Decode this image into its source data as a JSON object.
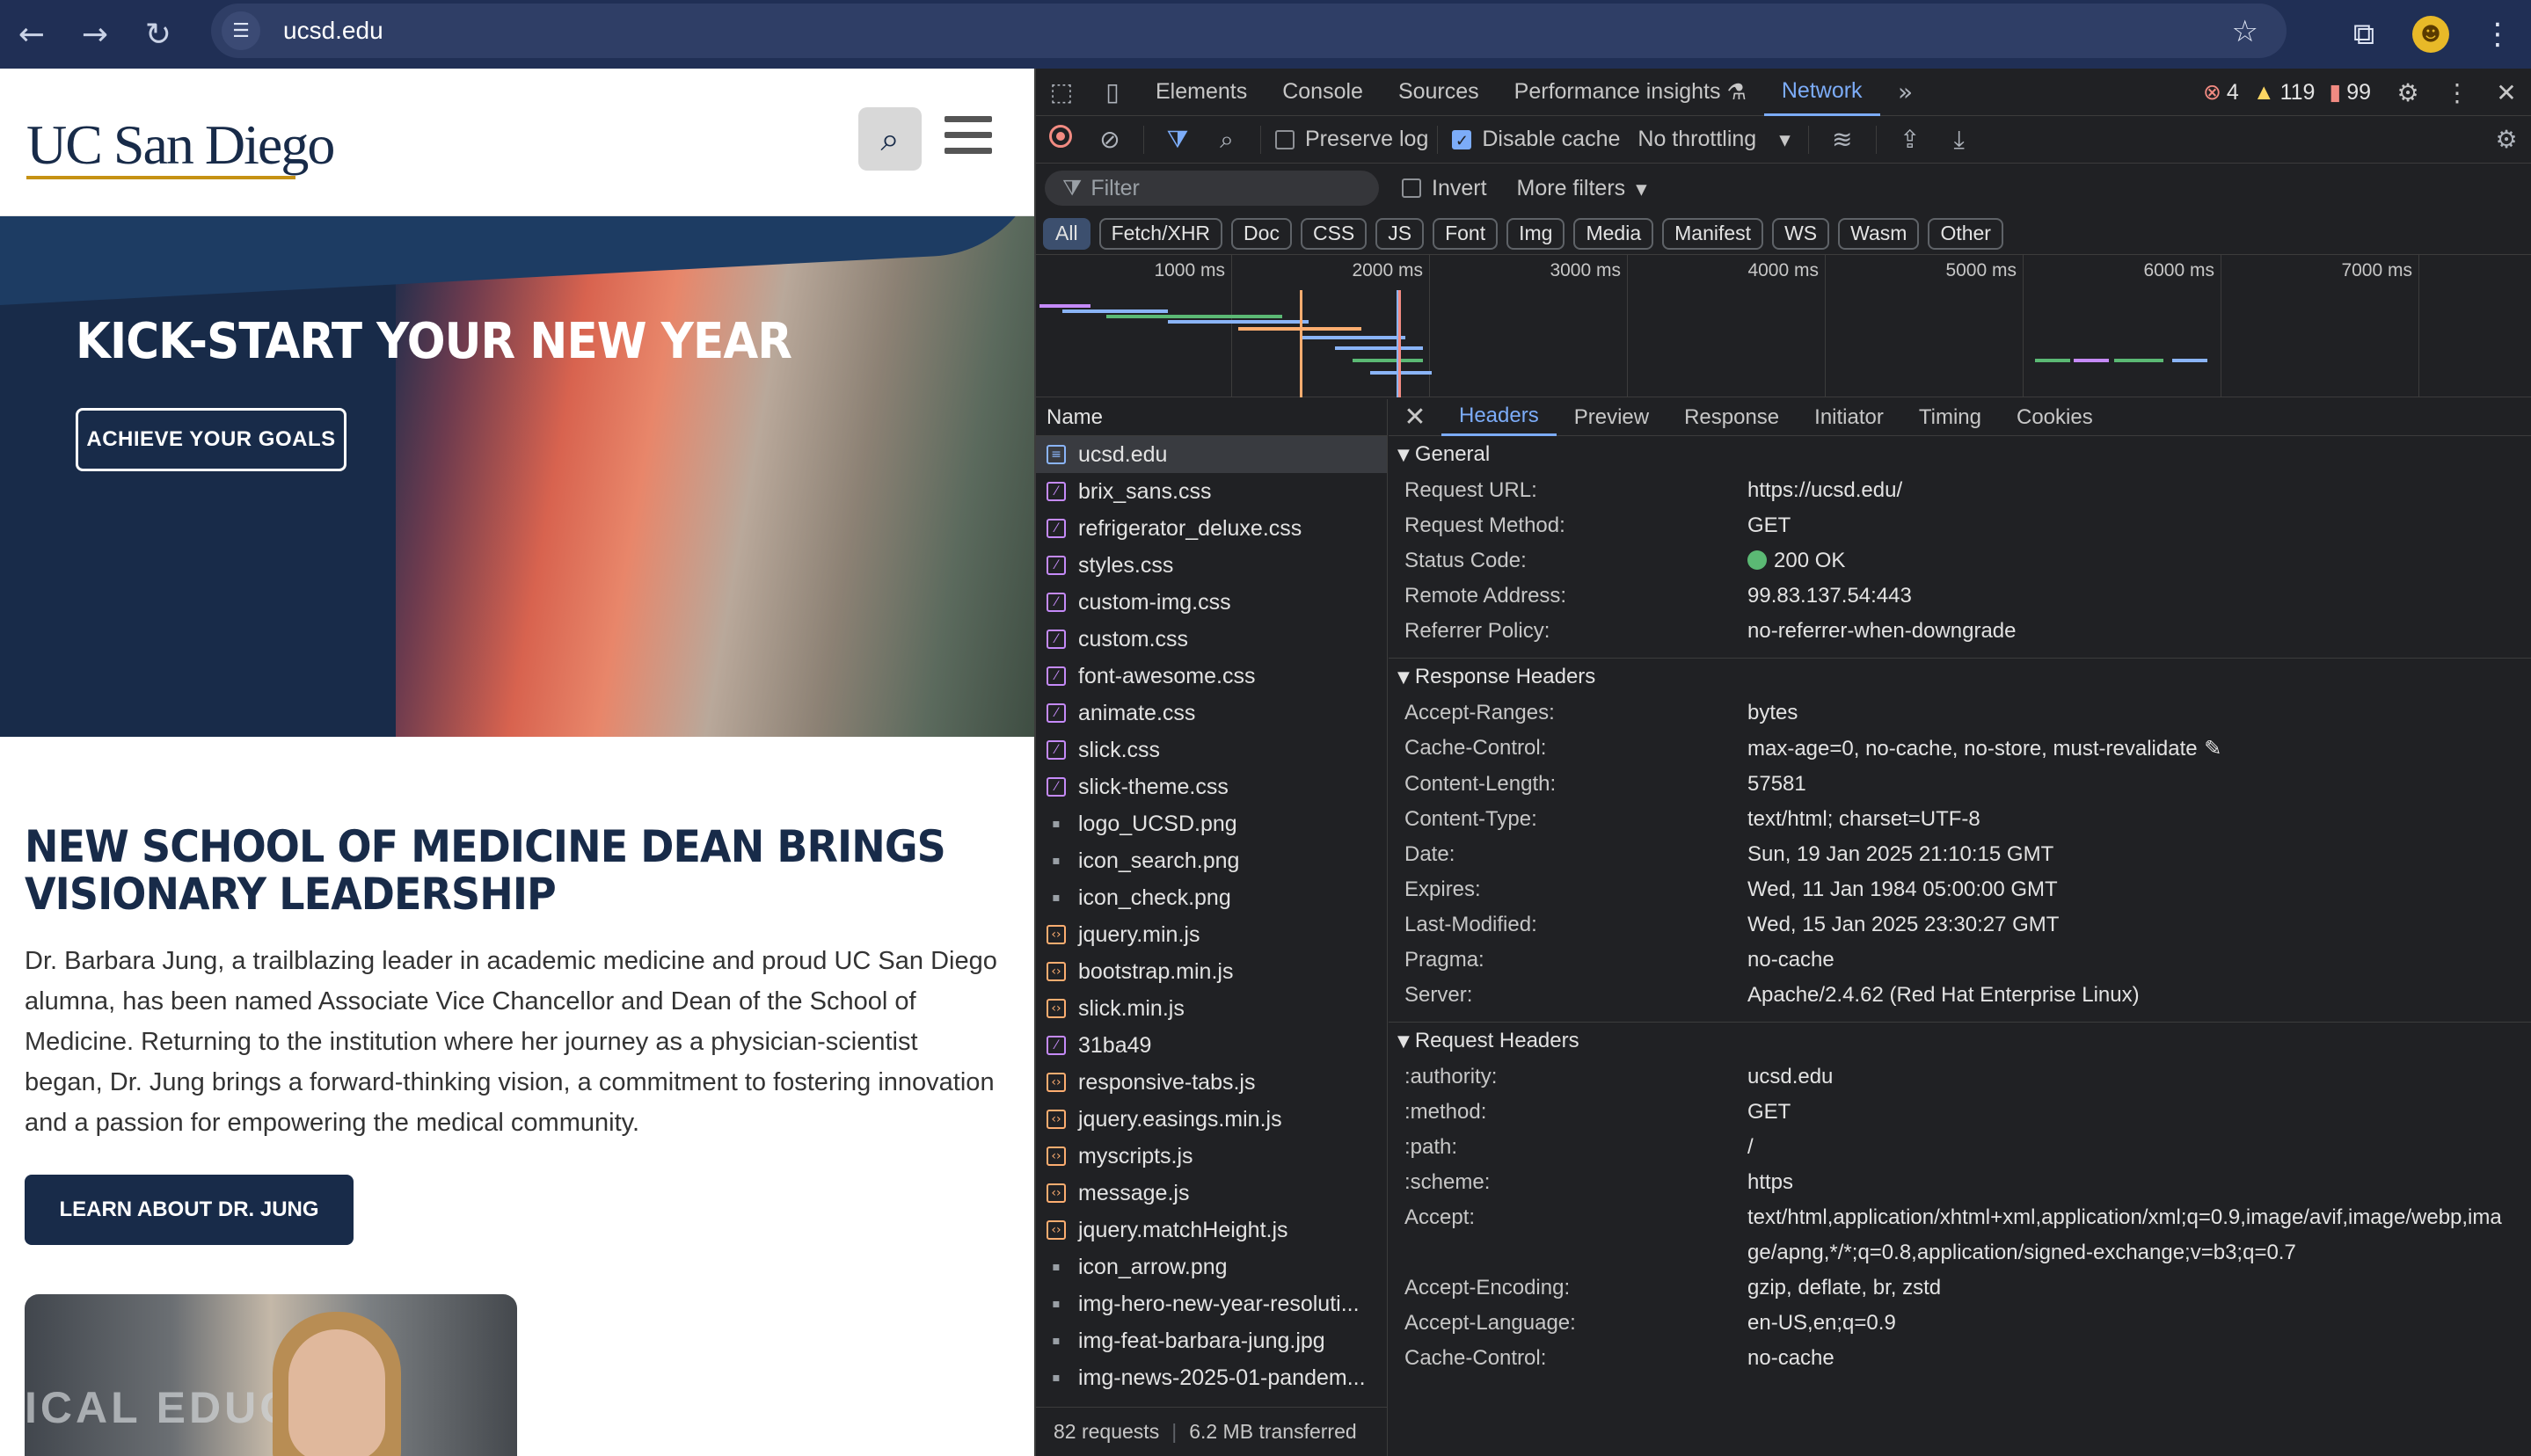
{
  "browser": {
    "url": "ucsd.edu",
    "icons": {
      "back": "arrow-left-icon",
      "forward": "arrow-right-icon",
      "reload": "reload-icon",
      "site_info": "tune-icon",
      "bookmark": "star-icon",
      "extensions": "puzzle-icon",
      "menu": "kebab-icon"
    }
  },
  "site": {
    "logo": "UC San Diego",
    "hero": {
      "title": "KICK-START YOUR NEW YEAR",
      "button": "ACHIEVE YOUR GOALS"
    },
    "story": {
      "title": "NEW SCHOOL OF MEDICINE DEAN BRINGS VISIONARY LEADERSHIP",
      "body": "Dr. Barbara Jung, a trailblazing leader in academic medicine and proud UC San Diego alumna, has been named Associate Vice Chancellor and Dean of the School of Medicine. Returning to the institution where her journey as a physician-scientist began, Dr. Jung brings a forward-thinking vision, a commitment to fostering innovation and a passion for empowering the medical community.",
      "button": "LEARN ABOUT DR. JUNG",
      "image_sign": "ICAL EDUCA"
    },
    "colors": {
      "navy": "#182b49",
      "gold": "#c69214"
    }
  },
  "devtools": {
    "tabs": [
      "Elements",
      "Console",
      "Sources",
      "Performance insights",
      "Network"
    ],
    "active_tab": "Network",
    "status": {
      "errors": "4",
      "warnings": "119",
      "issues": "99"
    },
    "toolbar": {
      "preserve_log": "Preserve log",
      "disable_cache": "Disable cache",
      "throttling": "No throttling"
    },
    "filter": {
      "placeholder": "Filter",
      "invert": "Invert",
      "more_filters": "More filters"
    },
    "types": [
      "All",
      "Fetch/XHR",
      "Doc",
      "CSS",
      "JS",
      "Font",
      "Img",
      "Media",
      "Manifest",
      "WS",
      "Wasm",
      "Other"
    ],
    "timeline_ticks": [
      "1000 ms",
      "2000 ms",
      "3000 ms",
      "4000 ms",
      "5000 ms",
      "6000 ms",
      "7000 ms"
    ],
    "name_header": "Name",
    "requests": [
      {
        "name": "ucsd.edu",
        "type": "doc"
      },
      {
        "name": "brix_sans.css",
        "type": "css"
      },
      {
        "name": "refrigerator_deluxe.css",
        "type": "css"
      },
      {
        "name": "styles.css",
        "type": "css"
      },
      {
        "name": "custom-img.css",
        "type": "css"
      },
      {
        "name": "custom.css",
        "type": "css"
      },
      {
        "name": "font-awesome.css",
        "type": "css"
      },
      {
        "name": "animate.css",
        "type": "css"
      },
      {
        "name": "slick.css",
        "type": "css"
      },
      {
        "name": "slick-theme.css",
        "type": "css"
      },
      {
        "name": "logo_UCSD.png",
        "type": "img"
      },
      {
        "name": "icon_search.png",
        "type": "img"
      },
      {
        "name": "icon_check.png",
        "type": "img"
      },
      {
        "name": "jquery.min.js",
        "type": "js"
      },
      {
        "name": "bootstrap.min.js",
        "type": "js"
      },
      {
        "name": "slick.min.js",
        "type": "js"
      },
      {
        "name": "31ba49",
        "type": "css"
      },
      {
        "name": "responsive-tabs.js",
        "type": "js"
      },
      {
        "name": "jquery.easings.min.js",
        "type": "js"
      },
      {
        "name": "myscripts.js",
        "type": "js"
      },
      {
        "name": "message.js",
        "type": "js"
      },
      {
        "name": "jquery.matchHeight.js",
        "type": "js"
      },
      {
        "name": "icon_arrow.png",
        "type": "img"
      },
      {
        "name": "img-hero-new-year-resoluti...",
        "type": "img"
      },
      {
        "name": "img-feat-barbara-jung.jpg",
        "type": "img"
      },
      {
        "name": "img-news-2025-01-pandem...",
        "type": "img"
      }
    ],
    "footer": {
      "requests": "82 requests",
      "transferred": "6.2 MB transferred"
    },
    "detail_tabs": [
      "Headers",
      "Preview",
      "Response",
      "Initiator",
      "Timing",
      "Cookies"
    ],
    "general": {
      "title": "General",
      "rows": [
        {
          "k": "Request URL:",
          "v": "https://ucsd.edu/"
        },
        {
          "k": "Request Method:",
          "v": "GET"
        },
        {
          "k": "Status Code:",
          "v": "200 OK"
        },
        {
          "k": "Remote Address:",
          "v": "99.83.137.54:443"
        },
        {
          "k": "Referrer Policy:",
          "v": "no-referrer-when-downgrade"
        }
      ]
    },
    "response_headers": {
      "title": "Response Headers",
      "rows": [
        {
          "k": "Accept-Ranges:",
          "v": "bytes"
        },
        {
          "k": "Cache-Control:",
          "v": "max-age=0, no-cache, no-store, must-revalidate"
        },
        {
          "k": "Content-Length:",
          "v": "57581"
        },
        {
          "k": "Content-Type:",
          "v": "text/html; charset=UTF-8"
        },
        {
          "k": "Date:",
          "v": "Sun, 19 Jan 2025 21:10:15 GMT"
        },
        {
          "k": "Expires:",
          "v": "Wed, 11 Jan 1984 05:00:00 GMT"
        },
        {
          "k": "Last-Modified:",
          "v": "Wed, 15 Jan 2025 23:30:27 GMT"
        },
        {
          "k": "Pragma:",
          "v": "no-cache"
        },
        {
          "k": "Server:",
          "v": "Apache/2.4.62 (Red Hat Enterprise Linux)"
        }
      ]
    },
    "request_headers": {
      "title": "Request Headers",
      "rows": [
        {
          "k": ":authority:",
          "v": "ucsd.edu"
        },
        {
          "k": ":method:",
          "v": "GET"
        },
        {
          "k": ":path:",
          "v": "/"
        },
        {
          "k": ":scheme:",
          "v": "https"
        },
        {
          "k": "Accept:",
          "v": "text/html,application/xhtml+xml,application/xml;q=0.9,image/avif,image/webp,image/apng,*/*;q=0.8,application/signed-exchange;v=b3;q=0.7"
        },
        {
          "k": "Accept-Encoding:",
          "v": "gzip, deflate, br, zstd"
        },
        {
          "k": "Accept-Language:",
          "v": "en-US,en;q=0.9"
        },
        {
          "k": "Cache-Control:",
          "v": "no-cache"
        }
      ]
    }
  }
}
